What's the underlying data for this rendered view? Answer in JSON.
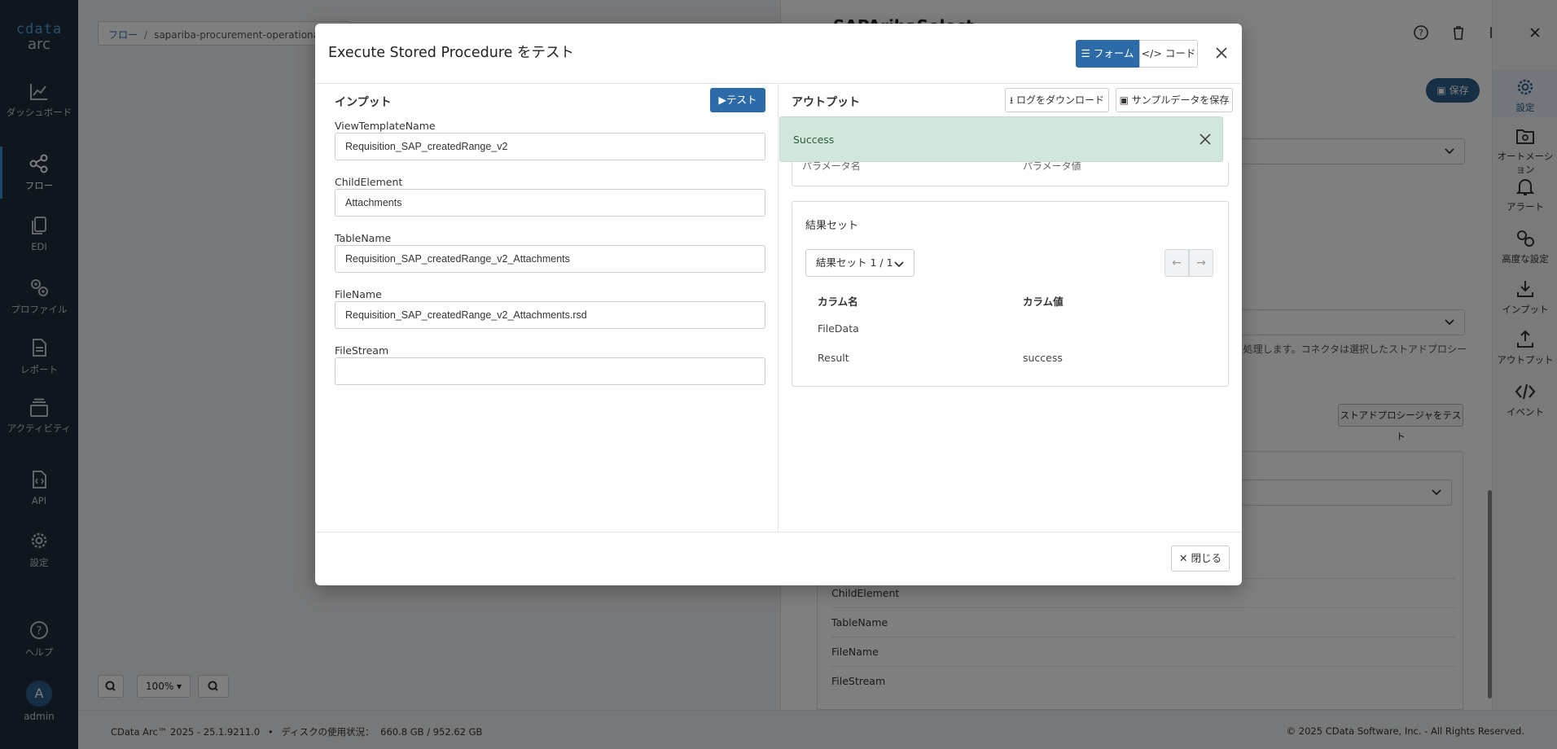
{
  "app": {
    "logo_brand": "cdata",
    "logo_product": "arc"
  },
  "leftnav": {
    "items": [
      {
        "label": "ダッシュボード",
        "icon": "chart-line-icon"
      },
      {
        "label": "フロー",
        "icon": "flow-icon"
      },
      {
        "label": "EDI",
        "icon": "documents-icon"
      },
      {
        "label": "プロファイル",
        "icon": "cogs-icon"
      },
      {
        "label": "レポート",
        "icon": "report-icon"
      },
      {
        "label": "アクティビティ",
        "icon": "stack-icon"
      },
      {
        "label": "API",
        "icon": "api-file-icon"
      },
      {
        "label": "設定",
        "icon": "gear-icon"
      },
      {
        "label": "ヘルプ",
        "icon": "help-icon"
      }
    ],
    "user_initial": "A",
    "user_name": "admin"
  },
  "canvas": {
    "breadcrumb_root": "フロー",
    "breadcrumb_separator": "/",
    "breadcrumb_current": "sapariba-procurement-operational-",
    "zoom_level": "100%"
  },
  "rpanel": {
    "title": "SAPAribaSelect",
    "save_label": "保存",
    "note": "…として処理します。コネクタは選択したストアドプロシー",
    "test_procedure_label": "ストアドプロシージャをテスト",
    "rows": [
      "ChildElement",
      "TableName",
      "FileName",
      "FileStream"
    ]
  },
  "rail": {
    "items": [
      {
        "label": "設定",
        "icon": "gear-icon"
      },
      {
        "label": "オートメーション",
        "icon": "automation-icon"
      },
      {
        "label": "アラート",
        "icon": "bell-icon"
      },
      {
        "label": "高度な設定",
        "icon": "cogs-icon"
      },
      {
        "label": "インプット",
        "icon": "download-icon"
      },
      {
        "label": "アウトプット",
        "icon": "upload-icon"
      },
      {
        "label": "イベント",
        "icon": "code-icon"
      }
    ]
  },
  "footer": {
    "version": "CData Arc™ 2025 - 25.1.9211.0",
    "bullet": "•",
    "disk_label": "ディスクの使用状況：",
    "disk_usage": "660.8 GB / 952.62 GB",
    "copyright": "© 2025 CData Software, Inc. - All Rights Reserved."
  },
  "modal": {
    "title": "Execute Stored Procedure をテスト",
    "form_label": "フォーム",
    "code_label": "コード",
    "input": {
      "title": "インプット",
      "test_label": "テスト",
      "fields": [
        {
          "label": "ViewTemplateName",
          "value": "Requisition_SAP_createdRange_v2"
        },
        {
          "label": "ChildElement",
          "value": "Attachments"
        },
        {
          "label": "TableName",
          "value": "Requisition_SAP_createdRange_v2_Attachments"
        },
        {
          "label": "FileName",
          "value": "Requisition_SAP_createdRange_v2_Attachments.rsd"
        },
        {
          "label": "FileStream",
          "value": ""
        }
      ]
    },
    "output": {
      "title": "アウトプット",
      "download_log_label": "ログをダウンロード",
      "save_sample_label": "サンプルデータを保存",
      "alert_text": "Success",
      "params_col_name": "パラメータ名",
      "params_col_value": "パラメータ値",
      "resultset_title": "結果セット",
      "resultset_select": "結果セット 1 / 1",
      "prev": "←",
      "next": "→",
      "col_name": "カラム名",
      "col_value": "カラム値",
      "rows": [
        {
          "name": "FileData",
          "value": ""
        },
        {
          "name": "Result",
          "value": "success"
        }
      ]
    },
    "close_label": "閉じる"
  },
  "colors": {
    "primary": "#2c6ba8",
    "nav_bg": "#1f2d3d",
    "success_bg": "#d2e7dc"
  }
}
